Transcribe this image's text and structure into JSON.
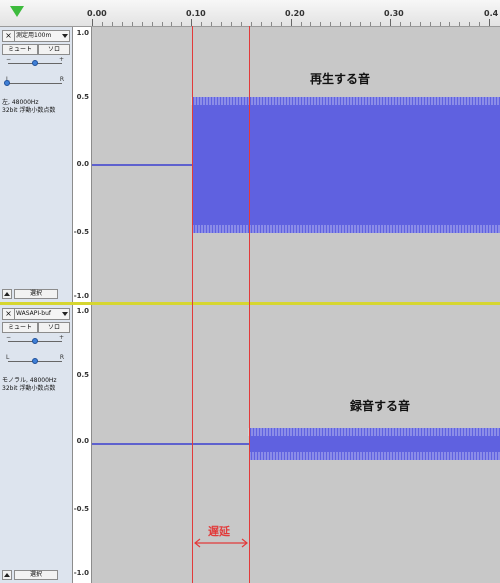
{
  "ruler": {
    "labels": [
      "0.00",
      "0.10",
      "0.20",
      "0.30",
      "0.4"
    ]
  },
  "tracks": [
    {
      "name": "測定用100m",
      "mute_label": "ミュート",
      "solo_label": "ソロ",
      "gain_minus": "−",
      "gain_plus": "+",
      "pan_left": "L",
      "pan_right": "R",
      "info_line1": "左, 48000Hz",
      "info_line2": "32bit 浮動小数点数",
      "select_label": "選択",
      "annotation": "再生する音"
    },
    {
      "name": "WASAPI-buf",
      "mute_label": "ミュート",
      "solo_label": "ソロ",
      "gain_minus": "−",
      "gain_plus": "+",
      "pan_left": "L",
      "pan_right": "R",
      "info_line1": "モノラル, 48000Hz",
      "info_line2": "32bit 浮動小数点数",
      "select_label": "選択",
      "annotation": "録音する音"
    }
  ],
  "vscale": {
    "labels": [
      "1.0",
      "0.5",
      "0.0",
      "-0.5",
      "-1.0"
    ]
  },
  "delay_label": "遅延",
  "colors": {
    "waveform": "#5f62e0",
    "waveform_dark": "#3a3fd0",
    "marker": "#e23a3a",
    "track_bg": "#c8c8c8"
  },
  "icons": {
    "play_head": "green-triangle",
    "close": "x-icon",
    "dropdown": "triangle-down",
    "collapse": "triangle-up"
  }
}
